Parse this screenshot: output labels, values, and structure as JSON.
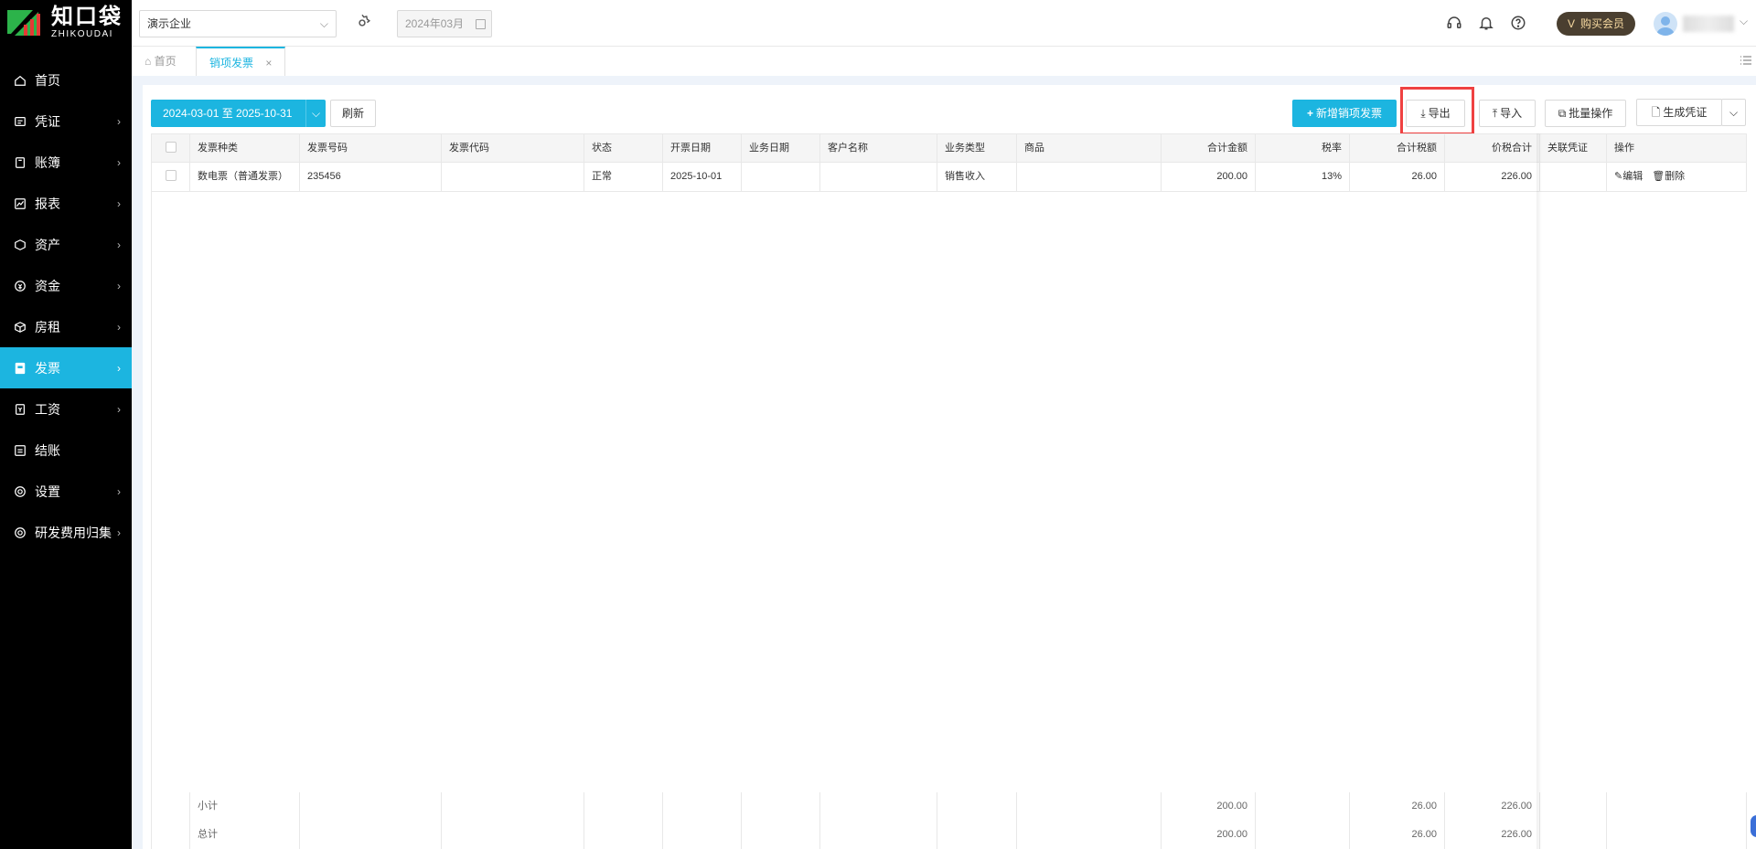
{
  "brand": {
    "name_cn": "知口袋",
    "name_en": "ZHIKOUDAI"
  },
  "sidebar": {
    "items": [
      {
        "label": "首页",
        "icon": "home-icon",
        "has_children": false,
        "active": false
      },
      {
        "label": "凭证",
        "icon": "voucher-icon",
        "has_children": true,
        "active": false
      },
      {
        "label": "账簿",
        "icon": "ledger-icon",
        "has_children": true,
        "active": false
      },
      {
        "label": "报表",
        "icon": "report-icon",
        "has_children": true,
        "active": false
      },
      {
        "label": "资产",
        "icon": "asset-icon",
        "has_children": true,
        "active": false
      },
      {
        "label": "资金",
        "icon": "fund-icon",
        "has_children": true,
        "active": false
      },
      {
        "label": "房租",
        "icon": "rent-icon",
        "has_children": true,
        "active": false
      },
      {
        "label": "发票",
        "icon": "invoice-icon",
        "has_children": true,
        "active": true
      },
      {
        "label": "工资",
        "icon": "salary-icon",
        "has_children": true,
        "active": false
      },
      {
        "label": "结账",
        "icon": "closing-icon",
        "has_children": false,
        "active": false
      },
      {
        "label": "设置",
        "icon": "settings-icon",
        "has_children": true,
        "active": false
      },
      {
        "label": "研发费用归集",
        "icon": "rd-icon",
        "has_children": true,
        "active": false
      }
    ]
  },
  "header": {
    "company": "演示企业",
    "period": "2024年03月",
    "vip_label": "购买会员",
    "vip_badge": "V"
  },
  "tabs": {
    "home": "首页",
    "active": "销项发票",
    "close": "×"
  },
  "toolbar": {
    "date_range": "2024-03-01 至 2025-10-31",
    "refresh": "刷新",
    "add": "新增销项发票",
    "export": "导出",
    "import": "导入",
    "batch": "批量操作",
    "voucher": "生成凭证"
  },
  "table": {
    "columns": [
      "发票种类",
      "发票号码",
      "发票代码",
      "状态",
      "开票日期",
      "业务日期",
      "客户名称",
      "业务类型",
      "商品",
      "合计金额",
      "税率",
      "合计税额",
      "价税合计",
      "关联凭证",
      "操作"
    ],
    "rows": [
      {
        "type": "数电票（普通发票）",
        "number": "235456",
        "code": "",
        "status": "正常",
        "issue_date": "2025-10-01",
        "biz_date": "",
        "customer": "",
        "biz_type": "销售收入",
        "goods": "",
        "amount": "200.00",
        "tax_rate": "13%",
        "tax": "26.00",
        "total": "226.00",
        "voucher": "",
        "edit": "编辑",
        "delete": "删除"
      }
    ],
    "subtotal": {
      "label": "小计",
      "amount": "200.00",
      "tax": "26.00",
      "total": "226.00"
    },
    "grandtotal": {
      "label": "总计",
      "amount": "200.00",
      "tax": "26.00",
      "total": "226.00"
    }
  },
  "colors": {
    "accent": "#1cb5e0",
    "sidebar_bg": "#000000",
    "highlight": "#ef4141",
    "vip_bg": "#4a3f30"
  }
}
